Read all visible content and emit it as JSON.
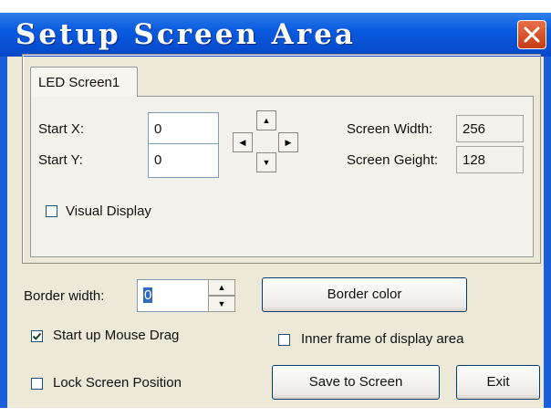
{
  "window": {
    "title": "Setup Screen Area"
  },
  "tab": {
    "label": "LED Screen1"
  },
  "panel": {
    "start_x_label": "Start X:",
    "start_x_value": "0",
    "start_y_label": "Start Y:",
    "start_y_value": "0",
    "screen_width_label": "Screen Width:",
    "screen_width_value": "256",
    "screen_height_label": "Screen Geight:",
    "screen_height_value": "128",
    "visual_display_label": "Visual Display",
    "visual_display_checked": false
  },
  "border": {
    "width_label": "Border width:",
    "width_value": "0",
    "color_button_label": "Border color"
  },
  "options": {
    "mouse_drag_label": "Start up Mouse Drag",
    "mouse_drag_checked": true,
    "inner_frame_label": "Inner frame of display area",
    "inner_frame_checked": false,
    "lock_position_label": "Lock Screen Position",
    "lock_position_checked": false
  },
  "buttons": {
    "save_label": "Save to Screen",
    "exit_label": "Exit"
  },
  "icons": {
    "close": "close-icon",
    "arrow_up": "arrow-up-icon",
    "arrow_down": "arrow-down-icon",
    "arrow_left": "arrow-left-icon",
    "arrow_right": "arrow-right-icon"
  },
  "colors": {
    "titlebar": "#0a5ae0",
    "dialog_bg": "#ece9d8",
    "close_button": "#c63b12"
  }
}
